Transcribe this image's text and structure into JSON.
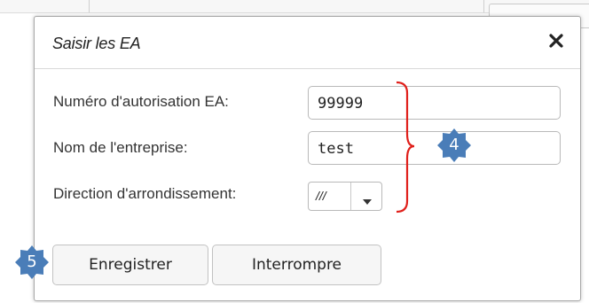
{
  "dialog": {
    "title": "Saisir les EA",
    "close_icon": "close-x-icon"
  },
  "form": {
    "authorization_label": "Numéro d'autorisation EA:",
    "authorization_value": "99999",
    "company_label": "Nom de l'entreprise:",
    "company_value": "test",
    "district_label": "Direction d'arrondissement:",
    "district_value": "///"
  },
  "buttons": {
    "save_label": "Enregistrer",
    "cancel_label": "Interrompre"
  },
  "annotations": {
    "badge_fields": "4",
    "badge_save": "5",
    "badge_color": "#4a7db8",
    "bracket_color": "#e0201b"
  }
}
